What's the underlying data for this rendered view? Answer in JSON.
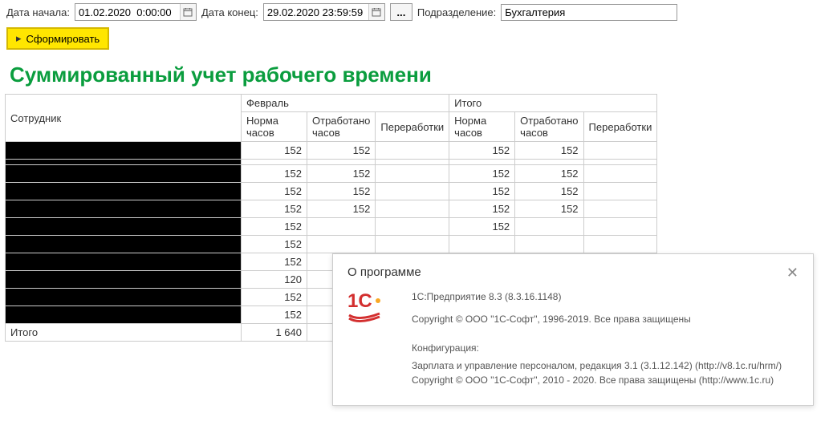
{
  "toolbar": {
    "date_start_label": "Дата начала:",
    "date_start_value": "01.02.2020  0:00:00",
    "date_end_label": "Дата конец:",
    "date_end_value": "29.02.2020 23:59:59",
    "dept_label": "Подразделение:",
    "dept_value": "Бухгалтерия",
    "form_button": "Сформировать"
  },
  "report": {
    "title": "Суммированный учет рабочего времени",
    "headers": {
      "employee": "Сотрудник",
      "month": "Февраль",
      "total": "Итого",
      "norm": "Норма часов",
      "worked": "Отработано часов",
      "overtime": "Переработки"
    },
    "rows": [
      {
        "norm": "152",
        "worked": "152",
        "t_norm": "152",
        "t_worked": "152"
      },
      {
        "norm": "",
        "worked": "",
        "t_norm": "",
        "t_worked": ""
      },
      {
        "norm": "152",
        "worked": "152",
        "t_norm": "152",
        "t_worked": "152"
      },
      {
        "norm": "152",
        "worked": "152",
        "t_norm": "152",
        "t_worked": "152"
      },
      {
        "norm": "152",
        "worked": "152",
        "t_norm": "152",
        "t_worked": "152"
      },
      {
        "norm": "152",
        "worked": "",
        "t_norm": "152",
        "t_worked": ""
      },
      {
        "norm": "152",
        "worked": "",
        "t_norm": "",
        "t_worked": ""
      },
      {
        "norm": "152",
        "worked": "",
        "t_norm": "",
        "t_worked": ""
      },
      {
        "norm": "120",
        "worked": "",
        "t_norm": "",
        "t_worked": ""
      },
      {
        "norm": "152",
        "worked": "",
        "t_norm": "",
        "t_worked": ""
      },
      {
        "norm": "152",
        "worked": "",
        "t_norm": "",
        "t_worked": ""
      }
    ],
    "total_label": "Итого",
    "total_norm": "1 640"
  },
  "about": {
    "title": "О программе",
    "line1": "1С:Предприятие 8.3 (8.3.16.1148)",
    "line2": "Copyright © ООО \"1С-Софт\", 1996-2019. Все права защищены",
    "config_label": "Конфигурация:",
    "config_text": "Зарплата и управление персоналом, редакция 3.1 (3.1.12.142) (http://v8.1c.ru/hrm/) Copyright © ООО \"1С-Софт\", 2010 - 2020. Все права защищены (http://www.1c.ru)"
  }
}
